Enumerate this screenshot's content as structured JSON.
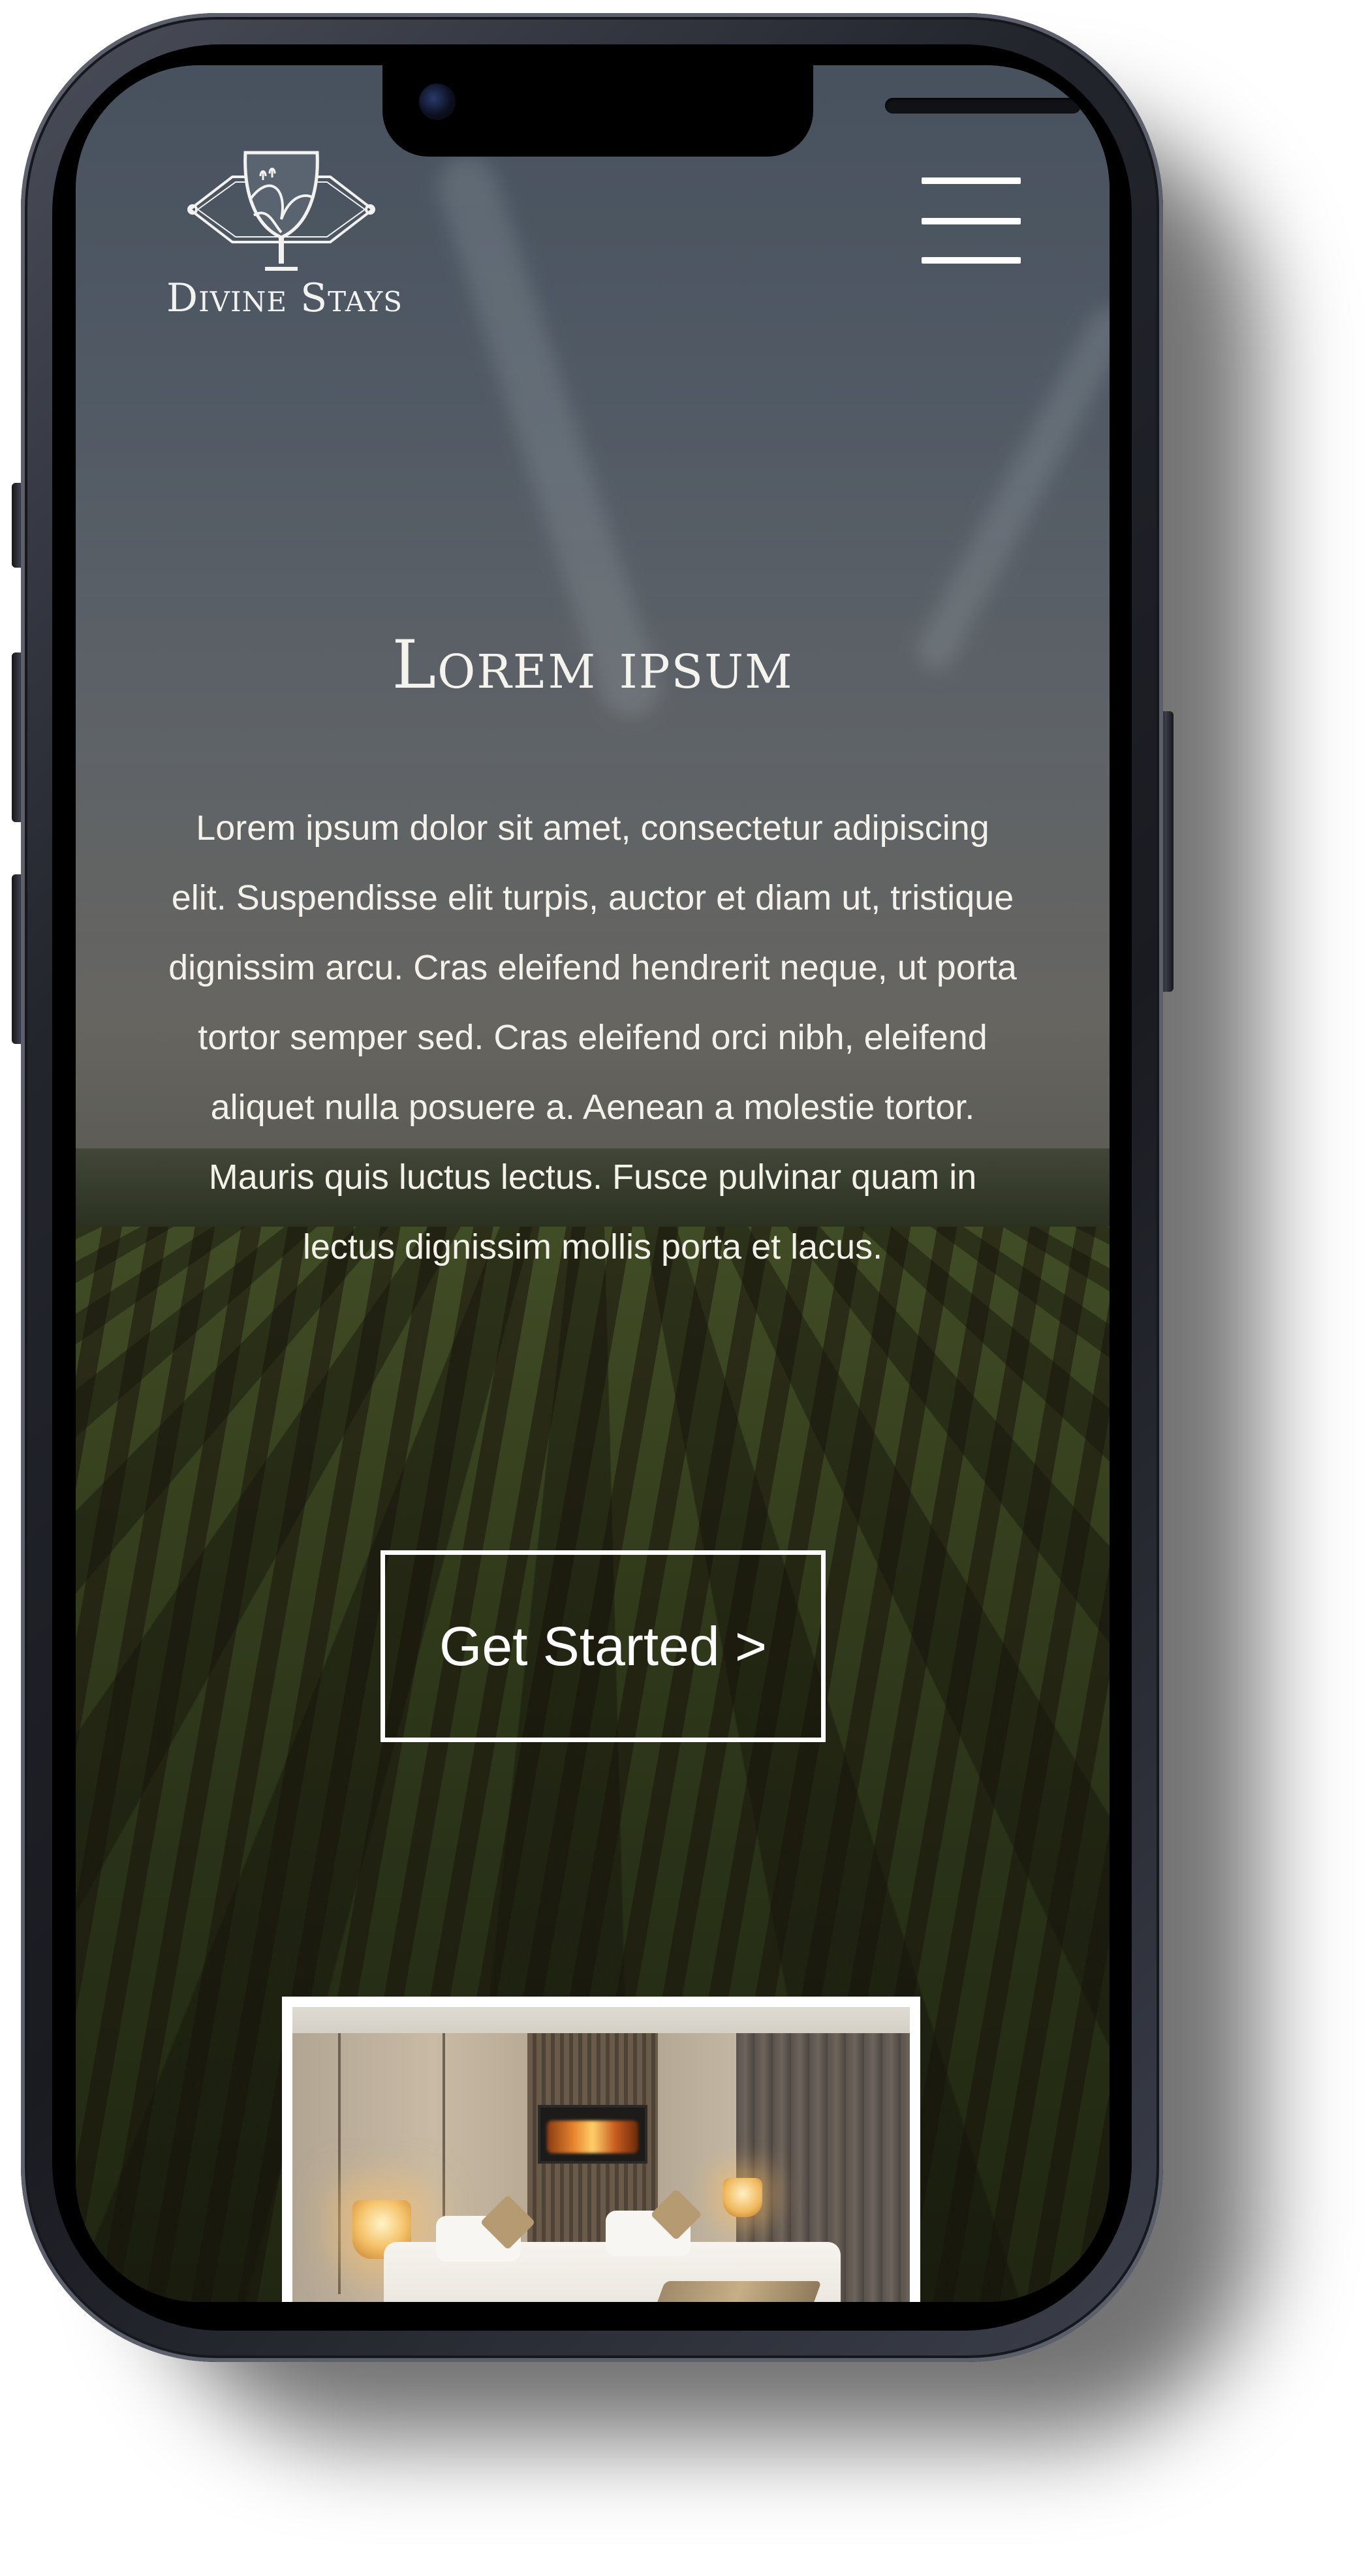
{
  "brand": {
    "name": "Divine Stays"
  },
  "nav": {
    "menu_icon": "hamburger-menu-icon"
  },
  "hero": {
    "title": "Lorem ipsum",
    "body": "Lorem ipsum dolor sit amet, consectetur adipiscing elit. Suspendisse elit turpis, auctor et diam ut, tristique dignissim arcu. Cras eleifend hendrerit neque, ut porta tortor semper sed. Cras eleifend orci nibh, eleifend aliquet nulla posuere a. Aenean a molestie tortor. Mauris quis luctus lectus. Fusce pulvinar quam in lectus dignissim mollis porta et lacus.",
    "cta_label": "Get Started >"
  },
  "colors": {
    "text": "#ffffff",
    "cta_border": "#ffffff",
    "card_border": "#ffffff"
  }
}
